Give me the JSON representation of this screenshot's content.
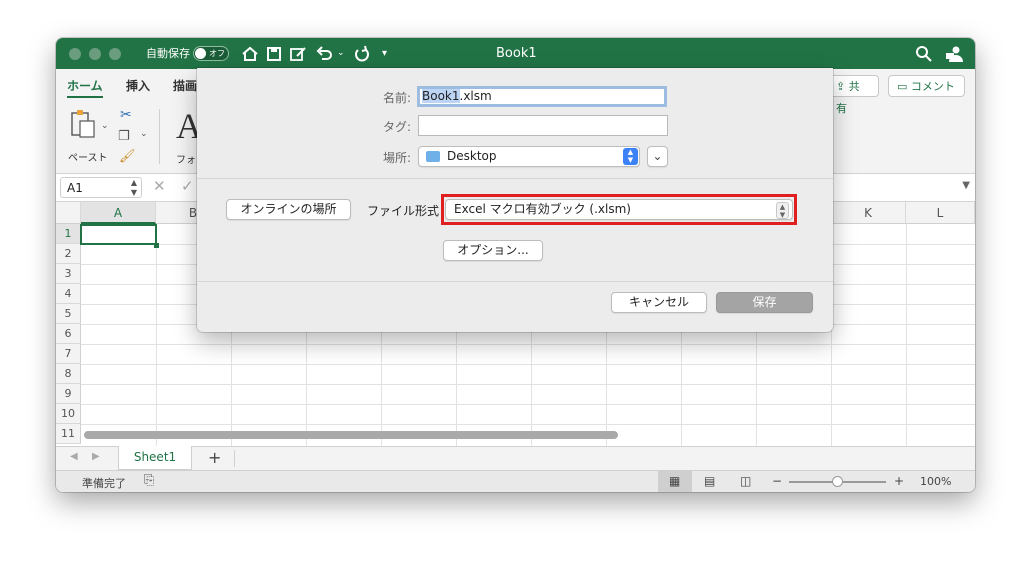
{
  "window": {
    "title": "Book1",
    "autosave_label": "自動保存",
    "autosave_state": "オフ"
  },
  "ribbon": {
    "tabs": [
      "ホーム",
      "挿入",
      "描画"
    ],
    "share_label": "共有",
    "comment_label": "コメント",
    "paste_label": "ペースト",
    "font_label": "フォン"
  },
  "formula_bar": {
    "name_box": "A1"
  },
  "grid": {
    "columns": [
      "A",
      "B",
      "K",
      "L"
    ],
    "rows": [
      "1",
      "2",
      "3",
      "4",
      "5",
      "6",
      "7",
      "8",
      "9",
      "10",
      "11"
    ],
    "selected_cell": "A1"
  },
  "sheets": {
    "tabs": [
      "Sheet1"
    ],
    "add_label": "+"
  },
  "status": {
    "ready": "準備完了",
    "zoom": "100%",
    "zoom_minus": "−",
    "zoom_plus": "+"
  },
  "dialog": {
    "name_label": "名前:",
    "name_selected": "Book1",
    "name_rest": ".xlsm",
    "tags_label": "タグ:",
    "tags_value": "",
    "location_label": "場所:",
    "location_value": "Desktop",
    "online_button": "オンラインの場所",
    "file_format_label": "ファイル形式",
    "file_format_value": "Excel マクロ有効ブック (.xlsm)",
    "options_button": "オプション...",
    "cancel_button": "キャンセル",
    "save_button": "保存"
  },
  "colors": {
    "accent": "#217346",
    "highlight_box": "#e02020",
    "selection": "#bcd5f5"
  }
}
